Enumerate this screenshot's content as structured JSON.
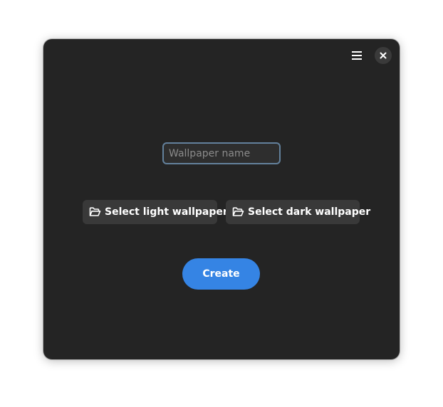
{
  "window": {
    "menu_icon": "hamburger-menu-icon",
    "close_icon": "close-icon"
  },
  "form": {
    "name_input": {
      "placeholder": "Wallpaper name",
      "value": ""
    },
    "select_light": {
      "label": "Select light wallpaper",
      "icon": "folder-open-icon"
    },
    "select_dark": {
      "label": "Select dark wallpaper",
      "icon": "folder-open-icon"
    },
    "create_label": "Create"
  },
  "colors": {
    "window_bg": "#242424",
    "button_bg": "#393939",
    "accent": "#3584e4",
    "focus_border": "#63819c"
  }
}
